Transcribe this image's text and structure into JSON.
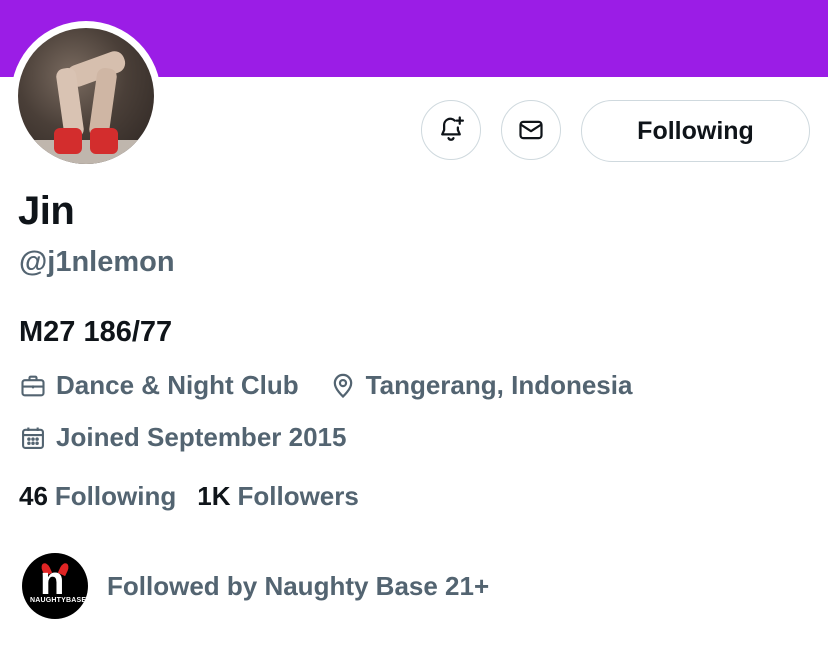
{
  "profile": {
    "name": "Jin",
    "handle": "@j1nlemon",
    "bio": "M27 186/77",
    "category": "Dance & Night Club",
    "location": "Tangerang, Indonesia",
    "joined": "Joined September 2015",
    "following_count": "46",
    "following_label": "Following",
    "followers_count": "1K",
    "followers_label": "Followers",
    "followed_by": "Followed by Naughty Base 21+",
    "follower_avatar_text": "NAUGHTYBASE"
  },
  "actions": {
    "follow_button": "Following",
    "notify_icon": "bell-plus-icon",
    "message_icon": "envelope-icon"
  },
  "colors": {
    "banner": "#9b1de6",
    "secondary_text": "#536471",
    "primary_text": "#0f1419",
    "border": "#cfd9de"
  }
}
